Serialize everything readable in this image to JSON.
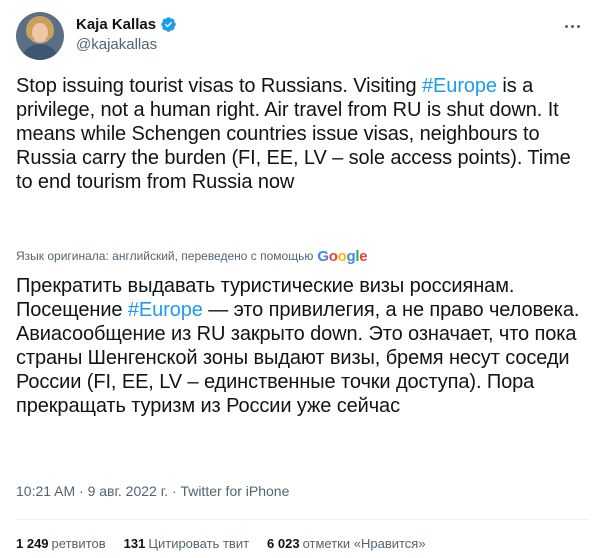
{
  "author": {
    "display_name": "Kaja Kallas",
    "handle": "@kajakallas",
    "verified": true,
    "verified_color": "#1d9bf0"
  },
  "tweet": {
    "text_part1": "Stop issuing tourist visas to Russians. Visiting ",
    "hashtag": "#Europe",
    "text_part2": " is a privilege, not a human right. Air travel from RU is shut down. It means while Schengen countries issue visas, neighbours to Russia carry the burden (FI, EE, LV – sole access points). Time to end tourism from Russia now"
  },
  "translation_note": {
    "label": "Язык оригинала: английский, переведено с помощью",
    "provider": "Google"
  },
  "translation": {
    "text_part1": "Прекратить выдавать туристические визы россиянам. Посещение ",
    "hashtag": "#Europe",
    "text_part2": " — это привилегия, а не право человека. Авиасообщение из RU закрыто down. Это означает, что пока страны Шенгенской зоны выдают визы, бремя несут соседи России (FI, EE, LV – единственные точки доступа). Пора прекращать туризм из России уже сейчас"
  },
  "meta": {
    "timestamp": "10:21 AM · 9 авг. 2022 г. · Twitter for iPhone"
  },
  "stats": {
    "retweets_count": "1 249",
    "retweets_label": "ретвитов",
    "quotes_count": "131",
    "quotes_label": "Цитировать твит",
    "likes_count": "6 023",
    "likes_label": "отметки «Нравится»"
  },
  "colors": {
    "accent": "#1d9bf0",
    "text": "#0f1419",
    "secondary": "#536471"
  }
}
